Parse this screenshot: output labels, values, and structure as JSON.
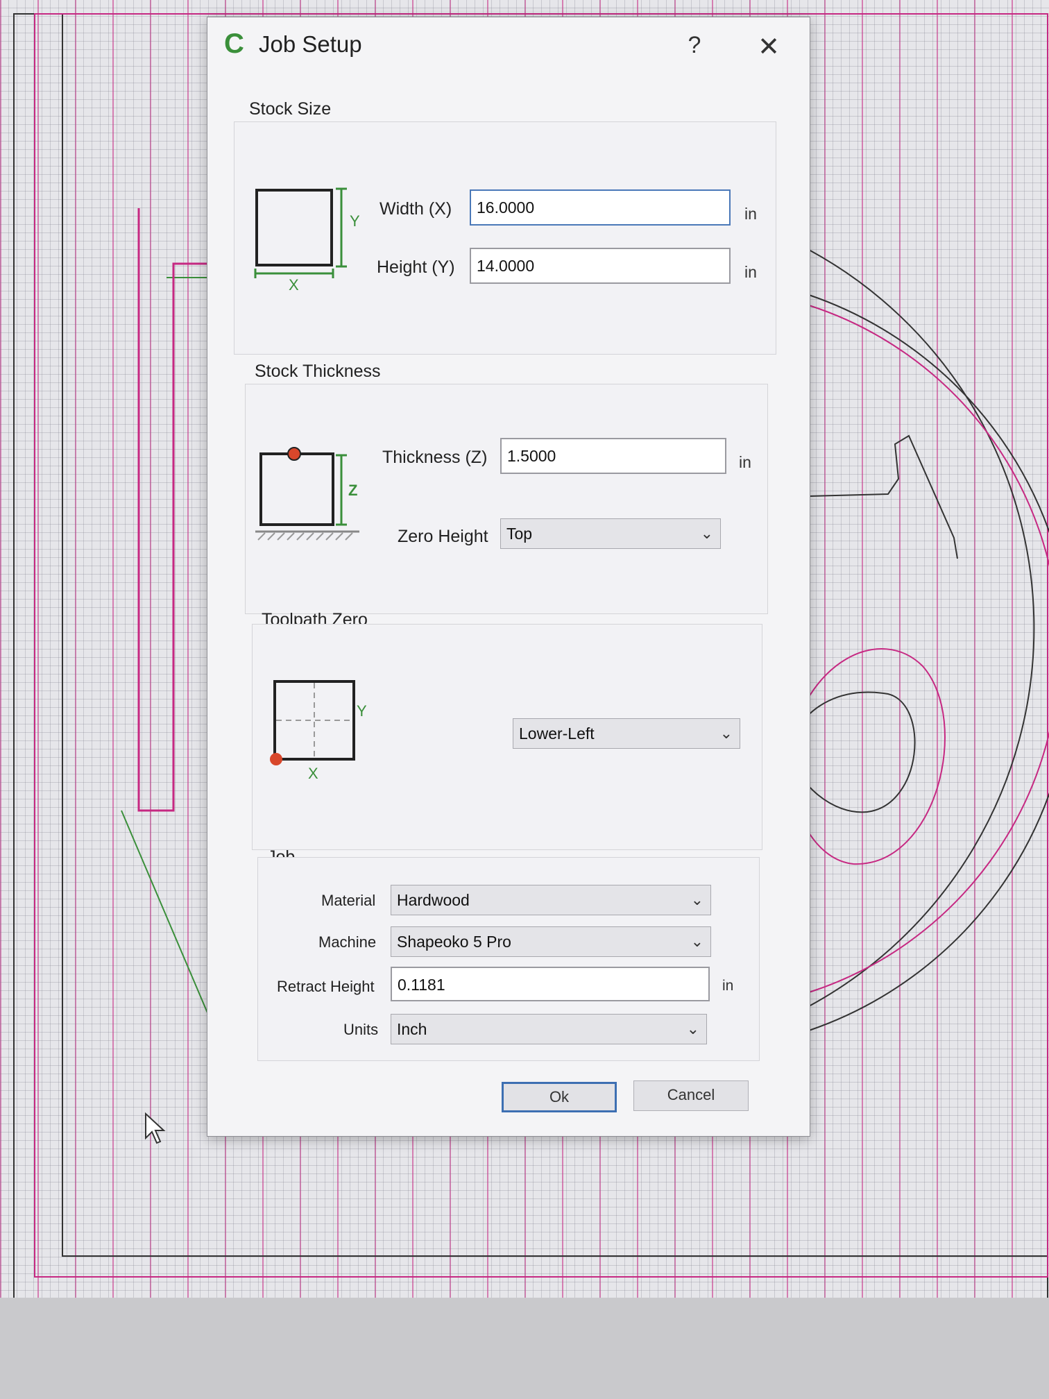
{
  "dialog": {
    "title": "Job Setup",
    "help_label": "?",
    "close_label": "✕"
  },
  "stock_size": {
    "title": "Stock Size",
    "width_label": "Width (X)",
    "width_value": "16.0000",
    "height_label": "Height (Y)",
    "height_value": "14.0000",
    "unit": "in",
    "axis_x": "X",
    "axis_y": "Y"
  },
  "stock_thickness": {
    "title": "Stock Thickness",
    "thickness_label": "Thickness (Z)",
    "thickness_value": "1.5000",
    "unit": "in",
    "zero_height_label": "Zero Height",
    "zero_height_value": "Top",
    "axis_z": "Z"
  },
  "toolpath_zero": {
    "title": "Toolpath Zero",
    "value": "Lower-Left",
    "axis_x": "X",
    "axis_y": "Y"
  },
  "job": {
    "title": "Job",
    "material_label": "Material",
    "material_value": "Hardwood",
    "machine_label": "Machine",
    "machine_value": "Shapeoko 5 Pro",
    "retract_label": "Retract Height",
    "retract_value": "0.1181",
    "retract_unit": "in",
    "units_label": "Units",
    "units_value": "Inch"
  },
  "buttons": {
    "ok": "Ok",
    "cancel": "Cancel"
  },
  "colors": {
    "accent_green": "#3a8f3a",
    "origin_red": "#d8472b",
    "focus_blue": "#4a78b8",
    "grid_magenta": "#c62882"
  }
}
